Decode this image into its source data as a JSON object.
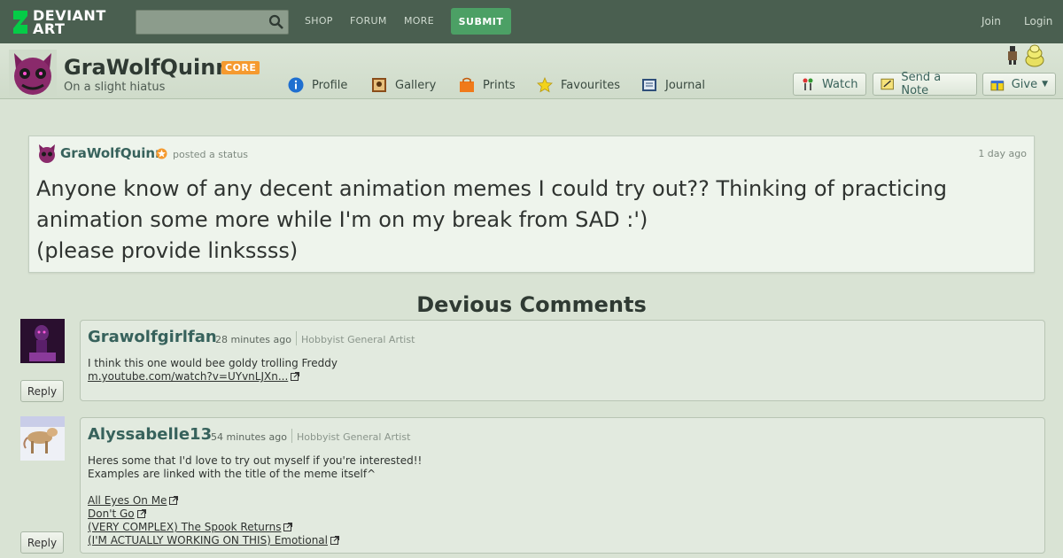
{
  "topbar": {
    "logo_line1": "DEVIANT",
    "logo_line2": "ART",
    "search_placeholder": "",
    "nav": [
      "SHOP",
      "FORUM",
      "MORE"
    ],
    "submit_label": "SUBMIT",
    "join_label": "Join",
    "login_label": "Login"
  },
  "profile": {
    "username": "GraWolfQuinn",
    "badge": "CORE",
    "tagline": "On a slight hiatus",
    "tabs": [
      {
        "label": "Profile",
        "icon": "info-icon"
      },
      {
        "label": "Gallery",
        "icon": "gallery-icon"
      },
      {
        "label": "Prints",
        "icon": "prints-bag-icon"
      },
      {
        "label": "Favourites",
        "icon": "star-icon"
      },
      {
        "label": "Journal",
        "icon": "journal-icon"
      }
    ],
    "watch_label": "Watch",
    "note_label": "Send a Note",
    "give_label": "Give"
  },
  "status": {
    "user": "GraWolfQuinn",
    "action": "posted a status",
    "time": "1 day ago",
    "text": "Anyone know of any decent animation memes I could try out?? Thinking of practicing\nanimation some more while I'm on my break from SAD :')\n(please provide linkssss)"
  },
  "comments_title": "Devious Comments",
  "comments": [
    {
      "name": "Grawolfgirlfan",
      "time": "28 minutes ago",
      "role": "Hobbyist General Artist",
      "lines": [
        "I think this one would bee goldy trolling Freddy"
      ],
      "links": [
        "m.youtube.com/watch?v=UYvnLJXn..."
      ],
      "reply_label": "Reply"
    },
    {
      "name": "Alyssabelle13",
      "time": "54 minutes ago",
      "role": "Hobbyist General Artist",
      "lines": [
        "Heres some that I'd love to try out myself if you're interested!!",
        "Examples are linked with the title of the meme itself^"
      ],
      "links": [
        "All Eyes On Me",
        "Don't Go",
        "(VERY COMPLEX) The Spook Returns",
        "(I'M ACTUALLY WORKING ON THIS) Emotional"
      ],
      "reply_label": "Reply"
    }
  ],
  "colors": {
    "topbar": "#4a5f50",
    "page_bg": "#d9e3d4",
    "accent_green": "#4ca065",
    "link_teal": "#37625c",
    "core_orange": "#f59a2f"
  }
}
